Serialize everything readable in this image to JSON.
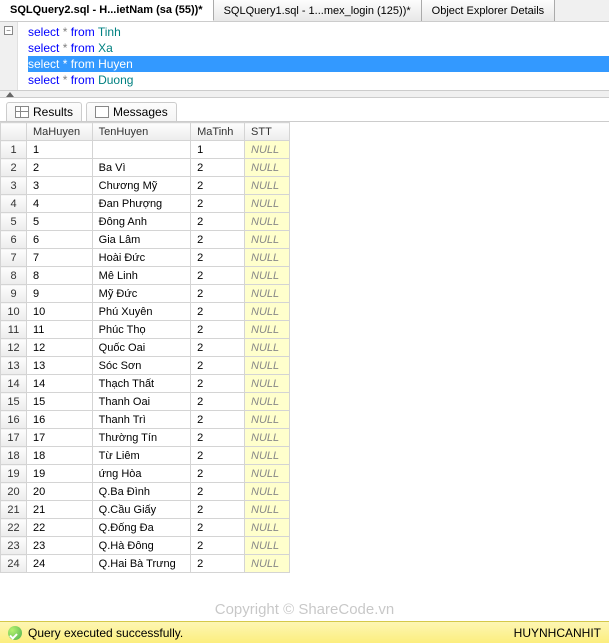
{
  "tabs": [
    {
      "label": "SQLQuery2.sql - H...ietNam (sa (55))*",
      "active": true
    },
    {
      "label": "SQLQuery1.sql - 1...mex_login (125))*",
      "active": false
    },
    {
      "label": "Object Explorer Details",
      "active": false
    }
  ],
  "brand": {
    "share": "SHARE",
    "code": "CODE",
    "vn": ".vn"
  },
  "sql": {
    "lines": [
      {
        "kw": "select",
        "star": "*",
        "from": "from",
        "obj": "Tinh",
        "selected": false
      },
      {
        "kw": "select",
        "star": "*",
        "from": "from",
        "obj": "Xa",
        "selected": false
      },
      {
        "kw": "select",
        "star": "*",
        "from": "from",
        "obj": "Huyen",
        "selected": true
      },
      {
        "kw": "select",
        "star": "*",
        "from": "from",
        "obj": "Duong",
        "selected": false
      }
    ]
  },
  "result_tabs": {
    "results": "Results",
    "messages": "Messages"
  },
  "columns": [
    "MaHuyen",
    "TenHuyen",
    "MaTinh",
    "STT"
  ],
  "rows": [
    {
      "n": "1",
      "MaHuyen": "1",
      "TenHuyen": "",
      "MaTinh": "1",
      "STT": "NULL"
    },
    {
      "n": "2",
      "MaHuyen": "2",
      "TenHuyen": "Ba Vì",
      "MaTinh": "2",
      "STT": "NULL"
    },
    {
      "n": "3",
      "MaHuyen": "3",
      "TenHuyen": "Chương Mỹ",
      "MaTinh": "2",
      "STT": "NULL"
    },
    {
      "n": "4",
      "MaHuyen": "4",
      "TenHuyen": "Đan Phượng",
      "MaTinh": "2",
      "STT": "NULL"
    },
    {
      "n": "5",
      "MaHuyen": "5",
      "TenHuyen": "Đông Anh",
      "MaTinh": "2",
      "STT": "NULL"
    },
    {
      "n": "6",
      "MaHuyen": "6",
      "TenHuyen": "Gia Lâm",
      "MaTinh": "2",
      "STT": "NULL"
    },
    {
      "n": "7",
      "MaHuyen": "7",
      "TenHuyen": "Hoài Đức",
      "MaTinh": "2",
      "STT": "NULL"
    },
    {
      "n": "8",
      "MaHuyen": "8",
      "TenHuyen": "Mê Linh",
      "MaTinh": "2",
      "STT": "NULL"
    },
    {
      "n": "9",
      "MaHuyen": "9",
      "TenHuyen": "Mỹ Đức",
      "MaTinh": "2",
      "STT": "NULL"
    },
    {
      "n": "10",
      "MaHuyen": "10",
      "TenHuyen": "Phú Xuyên",
      "MaTinh": "2",
      "STT": "NULL"
    },
    {
      "n": "11",
      "MaHuyen": "11",
      "TenHuyen": "Phúc Thọ",
      "MaTinh": "2",
      "STT": "NULL"
    },
    {
      "n": "12",
      "MaHuyen": "12",
      "TenHuyen": "Quốc Oai",
      "MaTinh": "2",
      "STT": "NULL"
    },
    {
      "n": "13",
      "MaHuyen": "13",
      "TenHuyen": "Sóc Sơn",
      "MaTinh": "2",
      "STT": "NULL"
    },
    {
      "n": "14",
      "MaHuyen": "14",
      "TenHuyen": "Thạch Thất",
      "MaTinh": "2",
      "STT": "NULL"
    },
    {
      "n": "15",
      "MaHuyen": "15",
      "TenHuyen": "Thanh Oai",
      "MaTinh": "2",
      "STT": "NULL"
    },
    {
      "n": "16",
      "MaHuyen": "16",
      "TenHuyen": "Thanh Trì",
      "MaTinh": "2",
      "STT": "NULL"
    },
    {
      "n": "17",
      "MaHuyen": "17",
      "TenHuyen": "Thường Tín",
      "MaTinh": "2",
      "STT": "NULL"
    },
    {
      "n": "18",
      "MaHuyen": "18",
      "TenHuyen": "Từ Liêm",
      "MaTinh": "2",
      "STT": "NULL"
    },
    {
      "n": "19",
      "MaHuyen": "19",
      "TenHuyen": "ứng Hòa",
      "MaTinh": "2",
      "STT": "NULL"
    },
    {
      "n": "20",
      "MaHuyen": "20",
      "TenHuyen": "Q.Ba Đình",
      "MaTinh": "2",
      "STT": "NULL"
    },
    {
      "n": "21",
      "MaHuyen": "21",
      "TenHuyen": "Q.Cầu Giấy",
      "MaTinh": "2",
      "STT": "NULL"
    },
    {
      "n": "22",
      "MaHuyen": "22",
      "TenHuyen": "Q.Đống Đa",
      "MaTinh": "2",
      "STT": "NULL"
    },
    {
      "n": "23",
      "MaHuyen": "23",
      "TenHuyen": "Q.Hà Đông",
      "MaTinh": "2",
      "STT": "NULL"
    },
    {
      "n": "24",
      "MaHuyen": "24",
      "TenHuyen": "Q.Hai Bà Trưng",
      "MaTinh": "2",
      "STT": "NULL"
    }
  ],
  "status": {
    "msg": "Query executed successfully.",
    "user": "HUYNHCANHIT"
  },
  "watermark": "Copyright © ShareCode.vn"
}
